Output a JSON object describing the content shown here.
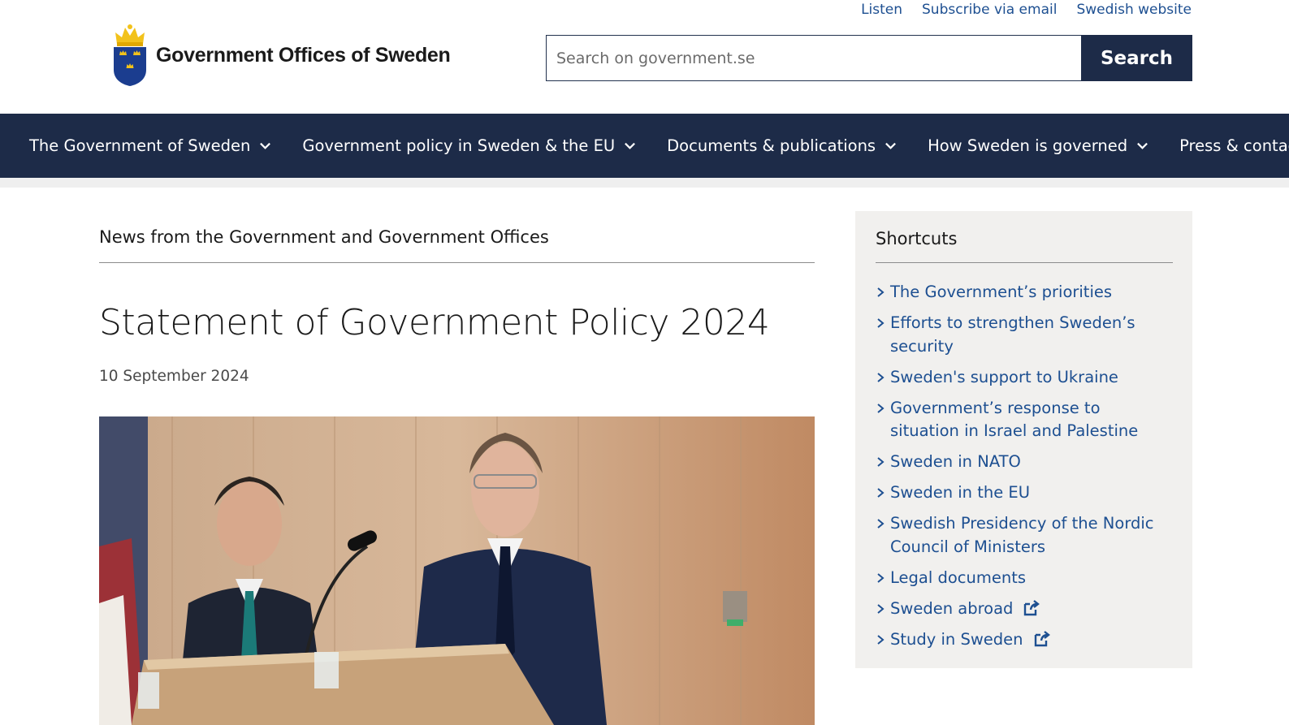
{
  "top_links": [
    "Listen",
    "Subscribe via email",
    "Swedish website"
  ],
  "logo": {
    "text": "Government Offices of Sweden"
  },
  "search": {
    "placeholder": "Search on government.se",
    "button_label": "Search"
  },
  "nav": {
    "items": [
      {
        "label": "The Government of Sweden"
      },
      {
        "label": "Government policy in Sweden & the EU"
      },
      {
        "label": "Documents & publications"
      },
      {
        "label": "How Sweden is governed"
      },
      {
        "label": "Press & contacts"
      }
    ]
  },
  "article": {
    "kicker": "News from the Government and Government Offices",
    "title": "Statement of Government Policy 2024",
    "date": "10 September 2024"
  },
  "shortcuts": {
    "title": "Shortcuts",
    "items": [
      {
        "label": "The Government’s priorities",
        "external": false
      },
      {
        "label": "Efforts to strengthen Sweden’s security",
        "external": false
      },
      {
        "label": "Sweden's support to Ukraine",
        "external": false
      },
      {
        "label": "Government’s response to situation in Israel and Palestine",
        "external": false
      },
      {
        "label": "Sweden in NATO",
        "external": false
      },
      {
        "label": "Sweden in the EU",
        "external": false
      },
      {
        "label": "Swedish Presidency of the Nordic Council of Ministers",
        "external": false
      },
      {
        "label": "Legal documents",
        "external": false
      },
      {
        "label": "Sweden abroad",
        "external": true
      },
      {
        "label": "Study in Sweden",
        "external": true
      }
    ]
  },
  "colors": {
    "navy": "#1d2b48",
    "link": "#1d4f91",
    "panel": "#f1f0ee",
    "crest_gold": "#f2c21b",
    "crest_blue": "#1b3d8f"
  }
}
